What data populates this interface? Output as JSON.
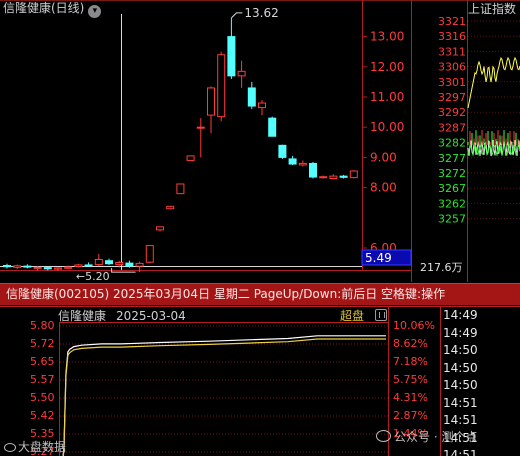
{
  "top": {
    "title": "信隆健康(日线)",
    "chevron_icon": "chevron-down-icon",
    "index_title": "上证指数",
    "y_ticks": [
      "13.00",
      "12.00",
      "11.00",
      "10.00",
      "9.00",
      "8.00",
      "6.00"
    ],
    "marker_low": "5.20",
    "marker_high": "13.62",
    "price_box": "5.49",
    "volume_label": "217.6万",
    "index_ticks": [
      "3321",
      "3316",
      "3311",
      "3306",
      "3301",
      "3297",
      "3292",
      "3287",
      "3282",
      "3277",
      "3272",
      "3267",
      "3262",
      "3257"
    ]
  },
  "banner": {
    "text": "信隆健康(002105) 2025年03月04日 星期二 PageUp/Down:前后日 空格键:操作"
  },
  "intraday": {
    "name": "信隆健康",
    "date": "2025-03-04",
    "super_label": "超盘",
    "price_ticks": [
      "5.80",
      "5.72",
      "5.65",
      "5.57",
      "5.50",
      "5.42",
      "5.35",
      "5.27"
    ],
    "pct_ticks": [
      "10.06%",
      "8.62%",
      "7.18%",
      "5.75%",
      "4.31%",
      "2.87%",
      "1.44%"
    ],
    "trade_times": [
      "14:49",
      "14:49",
      "14:50",
      "14:50",
      "14:50",
      "14:51",
      "14:51",
      "14:51",
      "14:51"
    ]
  },
  "watermarks": {
    "left": "大盘数据",
    "right": "公众号 · 测个点"
  },
  "colors": {
    "up": "#ff3a3a",
    "down": "#54ffff",
    "grid_red": "#b01e1e",
    "index_up": "#ffff4a",
    "index_down": "#3cff3c",
    "white": "#ffffff",
    "yellow": "#f0d040"
  },
  "chart_data": [
    {
      "type": "candlestick",
      "title": "信隆健康(日线)",
      "ylim": [
        5,
        13.62
      ],
      "candles": [
        {
          "o": 5.42,
          "c": 5.38,
          "h": 5.48,
          "l": 5.32
        },
        {
          "o": 5.36,
          "c": 5.41,
          "h": 5.45,
          "l": 5.3
        },
        {
          "o": 5.4,
          "c": 5.37,
          "h": 5.46,
          "l": 5.33
        },
        {
          "o": 5.33,
          "c": 5.36,
          "h": 5.4,
          "l": 5.25
        },
        {
          "o": 5.35,
          "c": 5.31,
          "h": 5.4,
          "l": 5.26
        },
        {
          "o": 5.3,
          "c": 5.34,
          "h": 5.38,
          "l": 5.24
        },
        {
          "o": 5.33,
          "c": 5.37,
          "h": 5.42,
          "l": 5.29
        },
        {
          "o": 5.39,
          "c": 5.44,
          "h": 5.48,
          "l": 5.36
        },
        {
          "o": 5.44,
          "c": 5.42,
          "h": 5.52,
          "l": 5.38
        },
        {
          "o": 5.45,
          "c": 5.62,
          "h": 5.8,
          "l": 5.4
        },
        {
          "o": 5.58,
          "c": 5.48,
          "h": 5.65,
          "l": 5.44
        },
        {
          "o": 5.45,
          "c": 5.52,
          "h": 5.58,
          "l": 5.35
        },
        {
          "o": 5.5,
          "c": 5.4,
          "h": 5.58,
          "l": 5.35
        },
        {
          "o": 5.4,
          "c": 5.49,
          "h": 5.55,
          "l": 5.2
        },
        {
          "o": 5.53,
          "c": 6.08,
          "h": 6.1,
          "l": 5.5
        },
        {
          "o": 6.6,
          "c": 6.7,
          "h": 6.72,
          "l": 6.55
        },
        {
          "o": 7.3,
          "c": 7.38,
          "h": 7.4,
          "l": 7.28
        },
        {
          "o": 7.8,
          "c": 8.12,
          "h": 8.12,
          "l": 7.8
        },
        {
          "o": 8.9,
          "c": 9.05,
          "h": 9.06,
          "l": 8.88
        },
        {
          "o": 10.0,
          "c": 10.0,
          "h": 10.3,
          "l": 9.0
        },
        {
          "o": 10.4,
          "c": 11.3,
          "h": 11.35,
          "l": 9.8
        },
        {
          "o": 10.35,
          "c": 12.4,
          "h": 12.5,
          "l": 10.2
        },
        {
          "o": 13.0,
          "c": 11.7,
          "h": 13.62,
          "l": 11.6
        },
        {
          "o": 11.7,
          "c": 11.85,
          "h": 12.2,
          "l": 11.3
        },
        {
          "o": 11.3,
          "c": 10.7,
          "h": 11.5,
          "l": 10.6
        },
        {
          "o": 10.65,
          "c": 10.8,
          "h": 10.9,
          "l": 10.4
        },
        {
          "o": 10.3,
          "c": 9.7,
          "h": 10.35,
          "l": 9.7
        },
        {
          "o": 9.4,
          "c": 9.0,
          "h": 9.42,
          "l": 8.95
        },
        {
          "o": 8.95,
          "c": 8.78,
          "h": 9.05,
          "l": 8.75
        },
        {
          "o": 8.75,
          "c": 8.8,
          "h": 8.9,
          "l": 8.7
        },
        {
          "o": 8.8,
          "c": 8.35,
          "h": 8.85,
          "l": 8.3
        },
        {
          "o": 8.34,
          "c": 8.36,
          "h": 8.4,
          "l": 8.3
        },
        {
          "o": 8.3,
          "c": 8.38,
          "h": 8.44,
          "l": 8.28
        },
        {
          "o": 8.38,
          "c": 8.34,
          "h": 8.42,
          "l": 8.3
        },
        {
          "o": 8.33,
          "c": 8.55,
          "h": 8.58,
          "l": 8.3
        }
      ]
    },
    {
      "type": "line",
      "title": "信隆健康 2025-03-04",
      "ylim": [
        5.27,
        5.8
      ],
      "x": [
        0,
        2,
        4,
        6,
        8,
        12,
        20,
        40,
        60,
        100,
        150,
        190,
        230,
        260,
        300,
        330
      ],
      "values": [
        5.27,
        5.35,
        5.62,
        5.7,
        5.71,
        5.72,
        5.725,
        5.73,
        5.73,
        5.735,
        5.74,
        5.745,
        5.75,
        5.76,
        5.76,
        5.76
      ]
    }
  ]
}
